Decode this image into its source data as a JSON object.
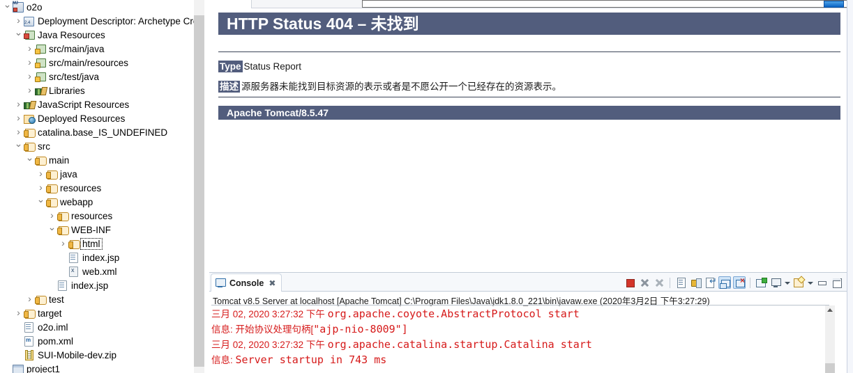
{
  "browser": {
    "address_value": "",
    "address_placeholder": "",
    "go_button_label": ""
  },
  "explorer": {
    "items": [
      {
        "label": "o2o",
        "indent": 0,
        "twisty": "open",
        "icon": "project-java-icon"
      },
      {
        "label": "Deployment Descriptor: Archetype Crea",
        "indent": 1,
        "twisty": "closed",
        "icon": "deployment-descriptor-icon"
      },
      {
        "label": "Java Resources",
        "indent": 1,
        "twisty": "open",
        "icon": "java-resources-icon"
      },
      {
        "label": "src/main/java",
        "indent": 2,
        "twisty": "closed",
        "icon": "source-package-icon"
      },
      {
        "label": "src/main/resources",
        "indent": 2,
        "twisty": "closed",
        "icon": "source-package-icon"
      },
      {
        "label": "src/test/java",
        "indent": 2,
        "twisty": "closed",
        "icon": "source-package-icon"
      },
      {
        "label": "Libraries",
        "indent": 2,
        "twisty": "closed",
        "icon": "libraries-icon"
      },
      {
        "label": "JavaScript Resources",
        "indent": 1,
        "twisty": "closed",
        "icon": "javascript-resources-icon"
      },
      {
        "label": "Deployed Resources",
        "indent": 1,
        "twisty": "closed",
        "icon": "deployed-resources-icon"
      },
      {
        "label": "catalina.base_IS_UNDEFINED",
        "indent": 1,
        "twisty": "closed",
        "icon": "folder-icon"
      },
      {
        "label": "src",
        "indent": 1,
        "twisty": "open",
        "icon": "folder-icon"
      },
      {
        "label": "main",
        "indent": 2,
        "twisty": "open",
        "icon": "folder-icon"
      },
      {
        "label": "java",
        "indent": 3,
        "twisty": "closed",
        "icon": "folder-icon"
      },
      {
        "label": "resources",
        "indent": 3,
        "twisty": "closed",
        "icon": "folder-icon"
      },
      {
        "label": "webapp",
        "indent": 3,
        "twisty": "open",
        "icon": "folder-icon"
      },
      {
        "label": "resources",
        "indent": 4,
        "twisty": "closed",
        "icon": "folder-icon"
      },
      {
        "label": "WEB-INF",
        "indent": 4,
        "twisty": "open",
        "icon": "folder-icon"
      },
      {
        "label": "html",
        "indent": 5,
        "twisty": "closed",
        "icon": "folder-icon",
        "focused": true
      },
      {
        "label": "index.jsp",
        "indent": 5,
        "twisty": "none",
        "icon": "jsp-file-icon"
      },
      {
        "label": "web.xml",
        "indent": 5,
        "twisty": "none",
        "icon": "xml-file-icon"
      },
      {
        "label": "index.jsp",
        "indent": 4,
        "twisty": "none",
        "icon": "jsp-file-icon"
      },
      {
        "label": "test",
        "indent": 2,
        "twisty": "closed",
        "icon": "folder-icon"
      },
      {
        "label": "target",
        "indent": 1,
        "twisty": "closed",
        "icon": "folder-icon"
      },
      {
        "label": "o2o.iml",
        "indent": 1,
        "twisty": "none",
        "icon": "file-icon"
      },
      {
        "label": "pom.xml",
        "indent": 1,
        "twisty": "none",
        "icon": "maven-pom-icon"
      },
      {
        "label": "SUI-Mobile-dev.zip",
        "indent": 1,
        "twisty": "none",
        "icon": "zip-file-icon"
      },
      {
        "label": "project1",
        "indent": 0,
        "twisty": "none",
        "icon": "project-icon"
      }
    ]
  },
  "error_page": {
    "title": "HTTP Status 404 – 未找到",
    "type_label": "Type",
    "type_value": "Status Report",
    "description_label": "描述",
    "description_value": "源服务器未能找到目标资源的表示或者是不愿公开一个已经存在的资源表示。",
    "footer": "Apache Tomcat/8.5.47",
    "accent_color": "#525D7D"
  },
  "console": {
    "tab_label": "Console",
    "tab_close": "✖",
    "launch_line": "Tomcat v8.5 Server at localhost [Apache Tomcat] C:\\Program Files\\Java\\jdk1.8.0_221\\bin\\javaw.exe (2020年3月2日 下午3:27:29)",
    "log_color": "#D61A1A",
    "lines": [
      {
        "prefix": "三月 02, 2020 3:27:32 下午 ",
        "mono": "org.apache.coyote.AbstractProtocol start"
      },
      {
        "prefix": "信息: 开始协议处理句柄[",
        "mono": "\"ajp-nio-8009\"]"
      },
      {
        "prefix": "三月 02, 2020 3:27:32 下午 ",
        "mono": "org.apache.catalina.startup.Catalina start"
      },
      {
        "prefix": "信息: ",
        "mono": "Server startup in 743 ms"
      }
    ],
    "toolbar": [
      {
        "name": "terminate-button",
        "glyph": "gl-stop",
        "active": false
      },
      {
        "name": "remove-launch-button",
        "glyph": "gl-x",
        "active": false
      },
      {
        "name": "remove-all-terminated-button",
        "glyph": "gl-xx",
        "active": false
      },
      {
        "name": "separator-1",
        "glyph": "sep",
        "active": false
      },
      {
        "name": "clear-console-button",
        "glyph": "gl-doc",
        "active": false
      },
      {
        "name": "scroll-lock-button",
        "glyph": "gl-lock",
        "active": false
      },
      {
        "name": "word-wrap-button",
        "glyph": "gl-wrap",
        "active": false
      },
      {
        "name": "show-console-on-output-button",
        "glyph": "gl-pin",
        "active": true
      },
      {
        "name": "show-console-on-error-button",
        "glyph": "gl-pinx",
        "active": true
      },
      {
        "name": "separator-2",
        "glyph": "sep",
        "active": false
      },
      {
        "name": "pin-console-button",
        "glyph": "gl-new",
        "active": false
      },
      {
        "name": "display-selected-console-button",
        "glyph": "gl-disp",
        "active": false
      },
      {
        "name": "display-selected-console-dropdown",
        "glyph": "arrow",
        "active": false
      },
      {
        "name": "open-console-button",
        "glyph": "gl-open",
        "active": false
      },
      {
        "name": "open-console-dropdown",
        "glyph": "arrow",
        "active": false
      },
      {
        "name": "minimize-panel-button",
        "glyph": "gl-min",
        "active": false
      },
      {
        "name": "maximize-panel-button",
        "glyph": "gl-max",
        "active": false
      }
    ]
  }
}
